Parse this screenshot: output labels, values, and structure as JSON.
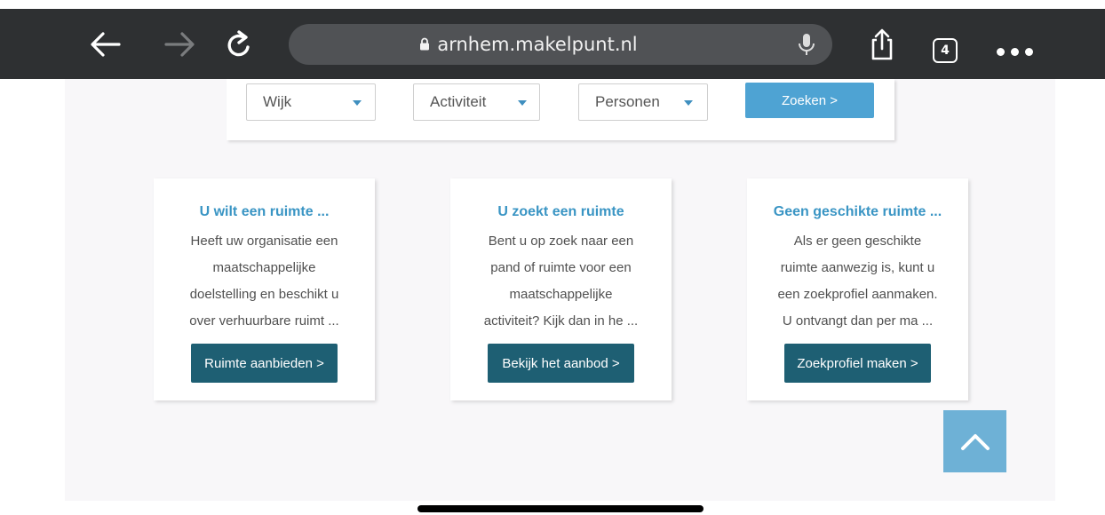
{
  "browser": {
    "url": "arnhem.makelpunt.nl",
    "tab_count": "4",
    "icons": {
      "back": "back-arrow-icon",
      "forward": "forward-arrow-icon",
      "reload": "reload-icon",
      "lock": "lock-icon",
      "mic": "microphone-icon",
      "share": "share-icon",
      "more": "more-dots-icon"
    }
  },
  "search": {
    "wijk": "Wijk",
    "activiteit": "Activiteit",
    "personen": "Personen",
    "button": "Zoeken >"
  },
  "cards": [
    {
      "title": "U wilt een ruimte  ...",
      "lines": [
        "Heeft uw organisatie een",
        "maatschappelijke",
        "doelstelling en beschikt u",
        "over verhuurbare ruimt  ..."
      ],
      "button": "Ruimte aanbieden >"
    },
    {
      "title": "U zoekt een ruimte",
      "lines": [
        "Bent u op zoek naar een",
        "pand of ruimte voor een",
        "maatschappelijke",
        "activiteit? Kijk dan in he  ..."
      ],
      "button": "Bekijk het aanbod >"
    },
    {
      "title": "Geen geschikte ruimte ...",
      "lines": [
        "Als er geen geschikte",
        "ruimte aanwezig is, kunt u",
        "een zoekprofiel aanmaken.",
        "U ontvangt dan per ma  ..."
      ],
      "button": "Zoekprofiel maken >"
    }
  ],
  "colors": {
    "toolbar": "#2e3032",
    "accent": "#3a95c4",
    "button_dark": "#1e5f73",
    "search_button": "#4ea3d3",
    "scroll_top": "#6eb1d6"
  }
}
